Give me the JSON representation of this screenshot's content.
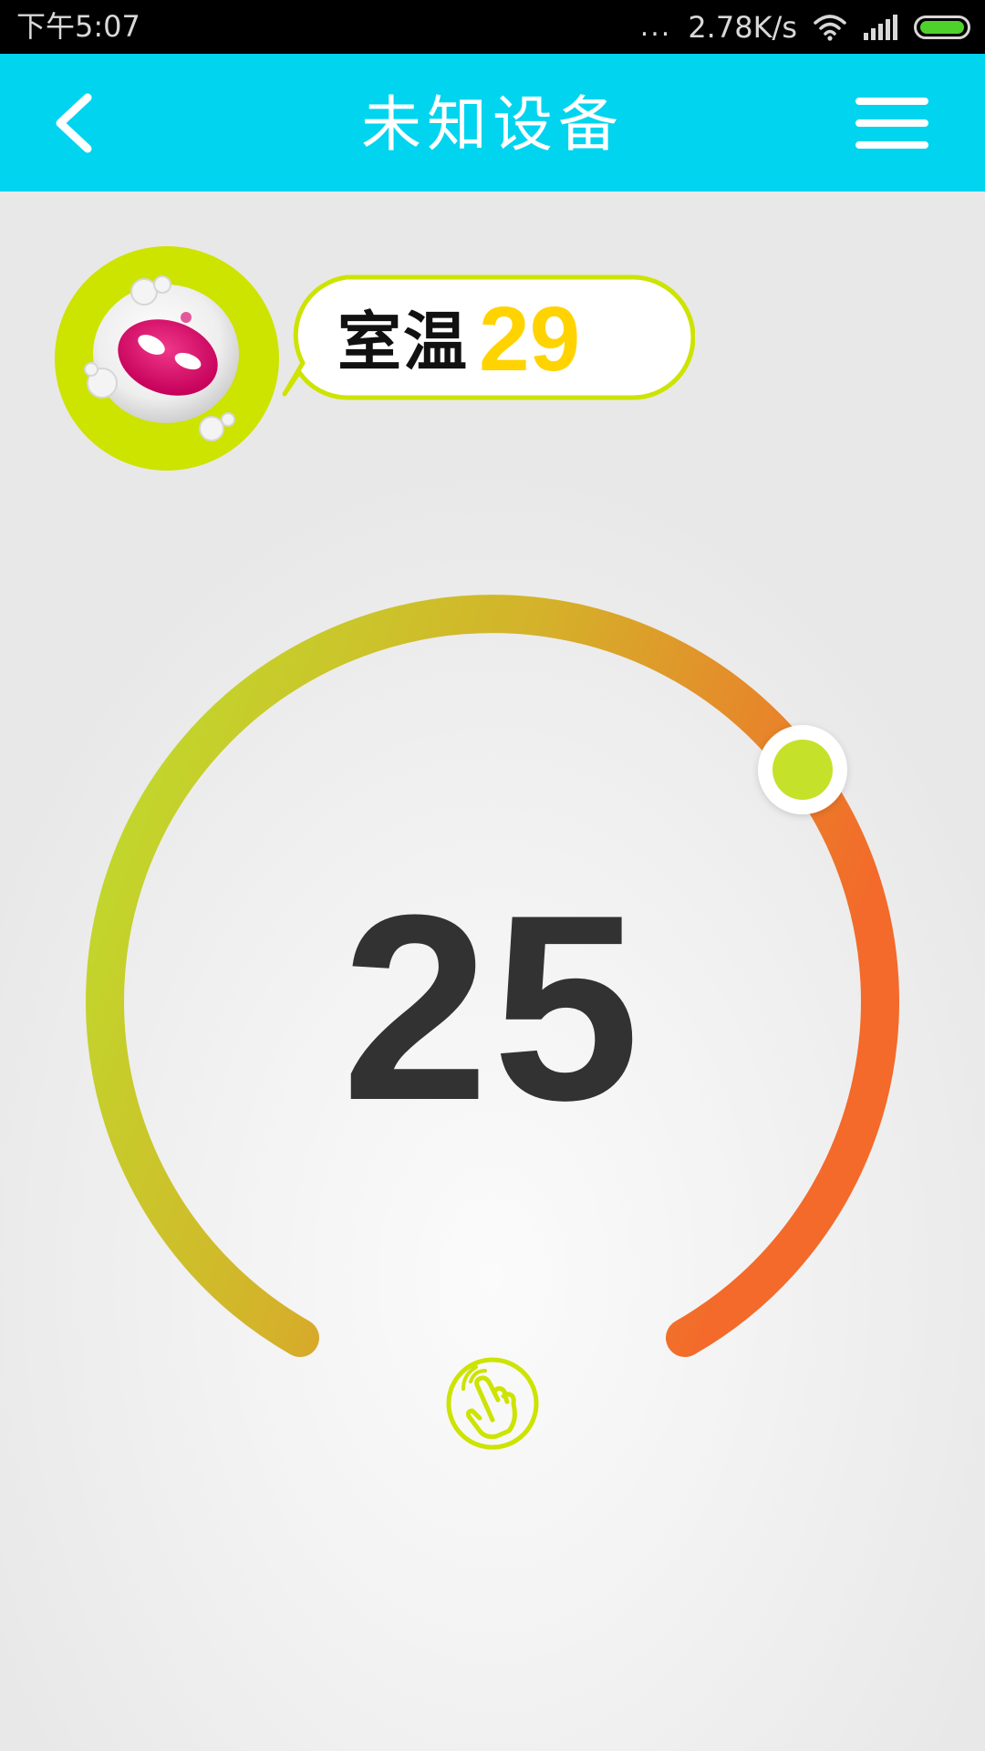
{
  "status_bar": {
    "time": "下午5:07",
    "dots": "...",
    "network_speed": "2.78K/s",
    "icons": [
      "wifi-icon",
      "signal-icon",
      "battery-icon"
    ]
  },
  "header": {
    "title": "未知设备",
    "back_icon": "chevron-left-icon",
    "menu_icon": "hamburger-menu-icon",
    "background_color": "#00d4ef"
  },
  "room_temp": {
    "label": "室温",
    "value": "29",
    "value_color": "#ffd300",
    "avatar_icon": "mascot-avatar-icon"
  },
  "thermostat": {
    "set_temperature": "25",
    "dial_gradient": [
      "#bde02c",
      "#d4b22a",
      "#f36a2a"
    ],
    "knob_color": "#c6e12a",
    "touch_icon": "tap-hand-icon"
  }
}
